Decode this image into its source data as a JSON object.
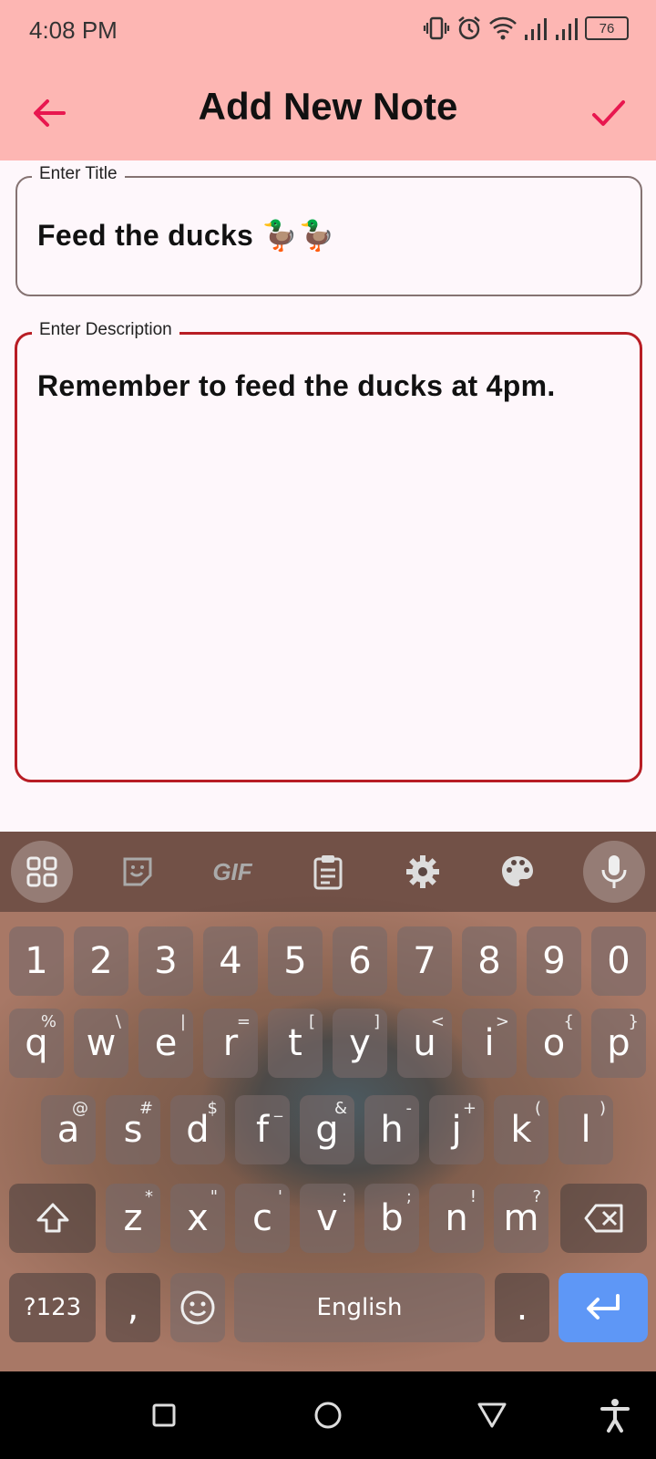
{
  "status_bar": {
    "time": "4:08 PM",
    "battery": "76",
    "icons": [
      "vibrate-icon",
      "alarm-icon",
      "wifi-icon",
      "signal-icon",
      "signal-icon",
      "battery-icon"
    ]
  },
  "app_bar": {
    "title": "Add New Note",
    "back_icon": "arrow-left-icon",
    "save_icon": "check-icon",
    "accent_color": "#e8174f"
  },
  "form": {
    "title_field": {
      "label": "Enter Title",
      "value": "Feed the ducks 🦆🦆"
    },
    "description_field": {
      "label": "Enter Description",
      "value": "Remember to feed the ducks at 4pm."
    }
  },
  "keyboard": {
    "toolbar": [
      "apps-grid-icon",
      "sticker-icon",
      "gif-icon",
      "clipboard-icon",
      "settings-icon",
      "palette-icon",
      "microphone-icon"
    ],
    "gif_label": "GIF",
    "number_row": [
      "1",
      "2",
      "3",
      "4",
      "5",
      "6",
      "7",
      "8",
      "9",
      "0"
    ],
    "row1": [
      {
        "k": "q",
        "a": "%"
      },
      {
        "k": "w",
        "a": "\\"
      },
      {
        "k": "e",
        "a": "|"
      },
      {
        "k": "r",
        "a": "="
      },
      {
        "k": "t",
        "a": "["
      },
      {
        "k": "y",
        "a": "]"
      },
      {
        "k": "u",
        "a": "<"
      },
      {
        "k": "i",
        "a": ">"
      },
      {
        "k": "o",
        "a": "{"
      },
      {
        "k": "p",
        "a": "}"
      }
    ],
    "row2": [
      {
        "k": "a",
        "a": "@"
      },
      {
        "k": "s",
        "a": "#"
      },
      {
        "k": "d",
        "a": "$"
      },
      {
        "k": "f",
        "a": "_"
      },
      {
        "k": "g",
        "a": "&"
      },
      {
        "k": "h",
        "a": "-"
      },
      {
        "k": "j",
        "a": "+"
      },
      {
        "k": "k",
        "a": "("
      },
      {
        "k": "l",
        "a": ")"
      }
    ],
    "row3": [
      {
        "k": "z",
        "a": "*"
      },
      {
        "k": "x",
        "a": "\""
      },
      {
        "k": "c",
        "a": "'"
      },
      {
        "k": "v",
        "a": ":"
      },
      {
        "k": "b",
        "a": ";"
      },
      {
        "k": "n",
        "a": "!"
      },
      {
        "k": "m",
        "a": "?"
      }
    ],
    "symbols_label": "?123",
    "comma": ",",
    "space_label": "English",
    "period": ".",
    "enter_color": "#5e97f6"
  },
  "nav_bar": [
    "recents-square-icon",
    "home-circle-icon",
    "back-triangle-icon",
    "accessibility-icon"
  ]
}
